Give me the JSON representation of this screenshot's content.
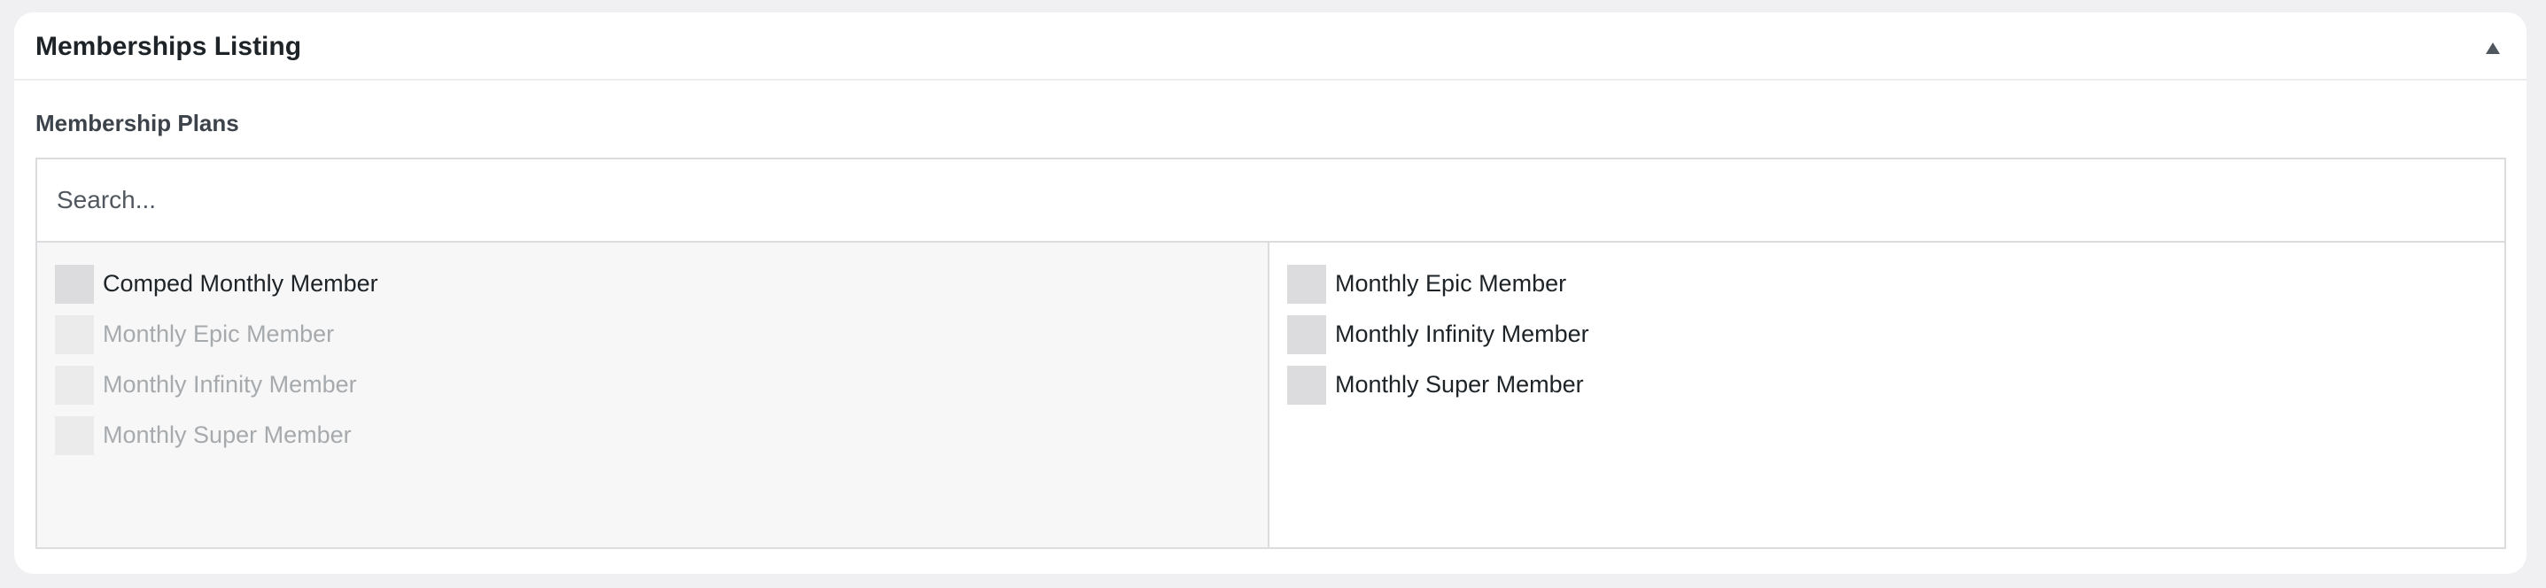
{
  "panel": {
    "title": "Memberships Listing"
  },
  "field": {
    "label": "Membership Plans"
  },
  "search": {
    "placeholder": "Search...",
    "value": ""
  },
  "available": {
    "items": [
      {
        "label": "Comped Monthly Member",
        "disabled": false
      },
      {
        "label": "Monthly Epic Member",
        "disabled": true
      },
      {
        "label": "Monthly Infinity Member",
        "disabled": true
      },
      {
        "label": "Monthly Super Member",
        "disabled": true
      }
    ]
  },
  "selected": {
    "items": [
      {
        "label": "Monthly Epic Member"
      },
      {
        "label": "Monthly Infinity Member"
      },
      {
        "label": "Monthly Super Member"
      }
    ]
  }
}
